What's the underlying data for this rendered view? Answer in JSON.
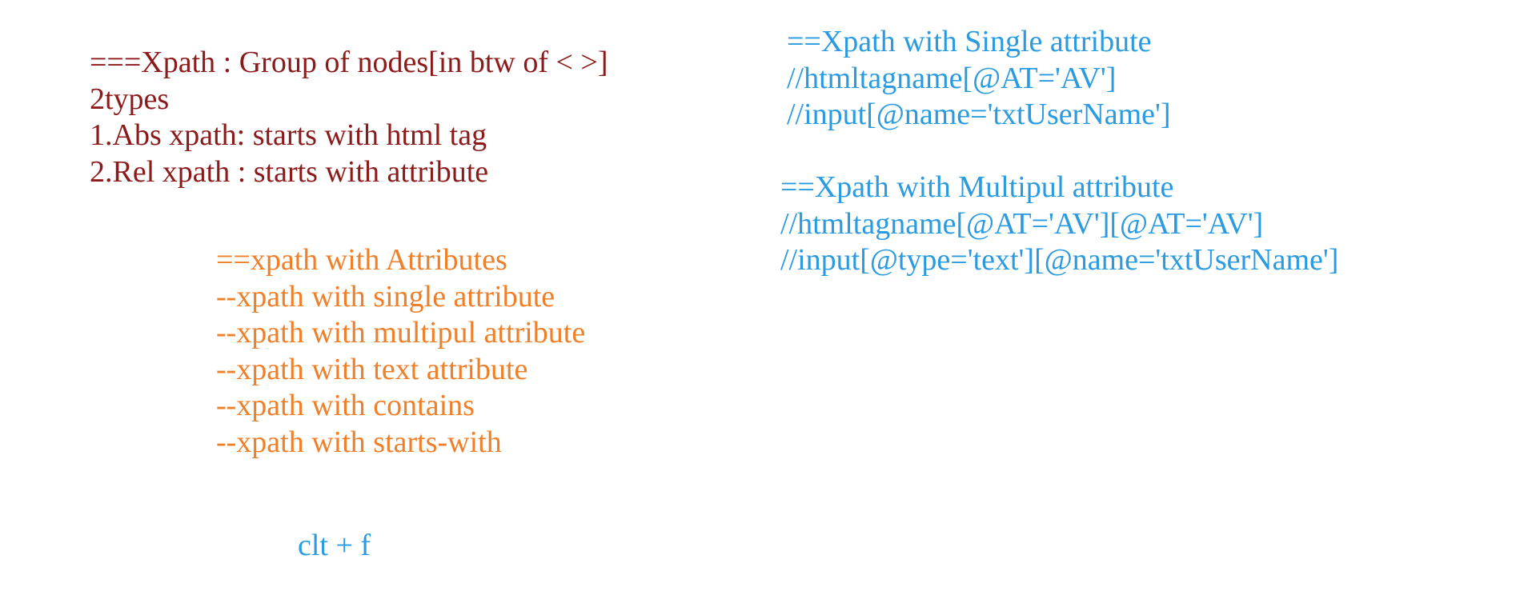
{
  "intro": {
    "lines": [
      "===Xpath : Group of nodes[in btw of < >]",
      "2types",
      "1.Abs xpath: starts with html tag",
      "2.Rel xpath : starts with attribute"
    ]
  },
  "attributes": {
    "lines": [
      "==xpath with Attributes",
      "--xpath with single attribute",
      "--xpath with multipul attribute",
      "--xpath with text attribute",
      "--xpath with contains",
      "--xpath with starts-with"
    ]
  },
  "shortcut": {
    "text": "clt + f"
  },
  "single_attribute": {
    "lines": [
      "==Xpath with Single attribute",
      "//htmltagname[@AT='AV']",
      "//input[@name='txtUserName']"
    ]
  },
  "multiple_attribute": {
    "lines": [
      "==Xpath with Multipul attribute",
      "//htmltagname[@AT='AV'][@AT='AV']",
      "//input[@type='text'][@name='txtUserName']"
    ]
  },
  "colors": {
    "intro": "#8B1A1A",
    "attributes": "#F07F2A",
    "xpath_examples": "#2A9BE0"
  }
}
